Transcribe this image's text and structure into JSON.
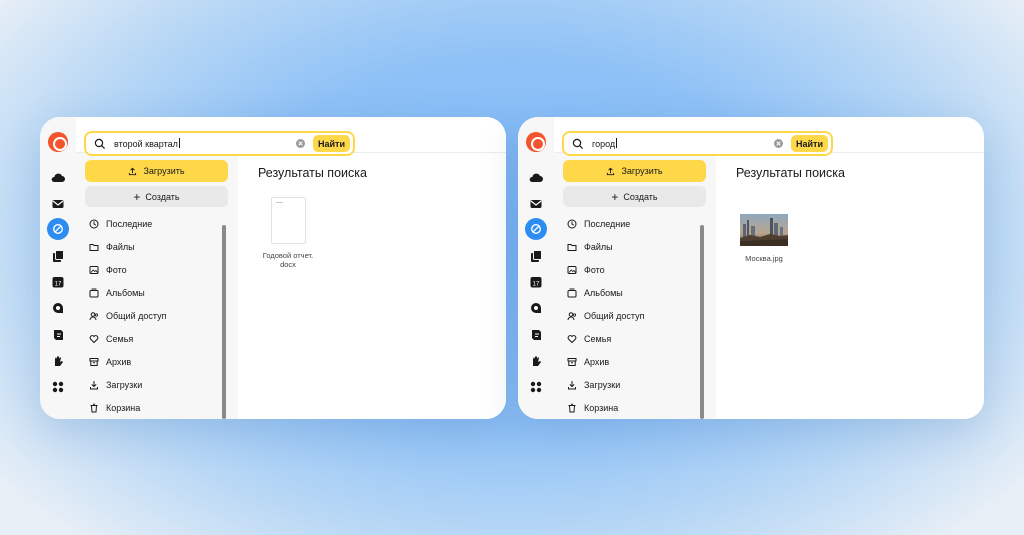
{
  "panels": [
    {
      "search": {
        "query": "второй квартал",
        "button": "Найти"
      },
      "sidebar": {
        "upload": "Загрузить",
        "create": "Создать",
        "items": [
          "Последние",
          "Файлы",
          "Фото",
          "Альбомы",
          "Общий доступ",
          "Семья",
          "Архив",
          "Загрузки",
          "Корзина"
        ]
      },
      "main": {
        "title": "Результаты поиска",
        "result": {
          "name_line1": "Годовой отчет.",
          "name_line2": "docx"
        }
      }
    },
    {
      "search": {
        "query": "город",
        "button": "Найти"
      },
      "sidebar": {
        "upload": "Загрузить",
        "create": "Создать",
        "items": [
          "Последние",
          "Файлы",
          "Фото",
          "Альбомы",
          "Общий доступ",
          "Семья",
          "Архив",
          "Загрузки",
          "Корзина"
        ]
      },
      "main": {
        "title": "Результаты поиска",
        "result": {
          "name": "Москва.jpg"
        }
      }
    }
  ],
  "colors": {
    "accent_yellow": "#ffd84a",
    "logo": "#f2542d",
    "active_icon": "#2c8cf0"
  },
  "rail_icons": [
    "logo-icon",
    "cloud-icon",
    "mail-icon",
    "disk-icon",
    "docs-icon",
    "calendar-icon",
    "telemost-icon",
    "notes-icon",
    "hand-icon",
    "apps-grid-icon"
  ]
}
